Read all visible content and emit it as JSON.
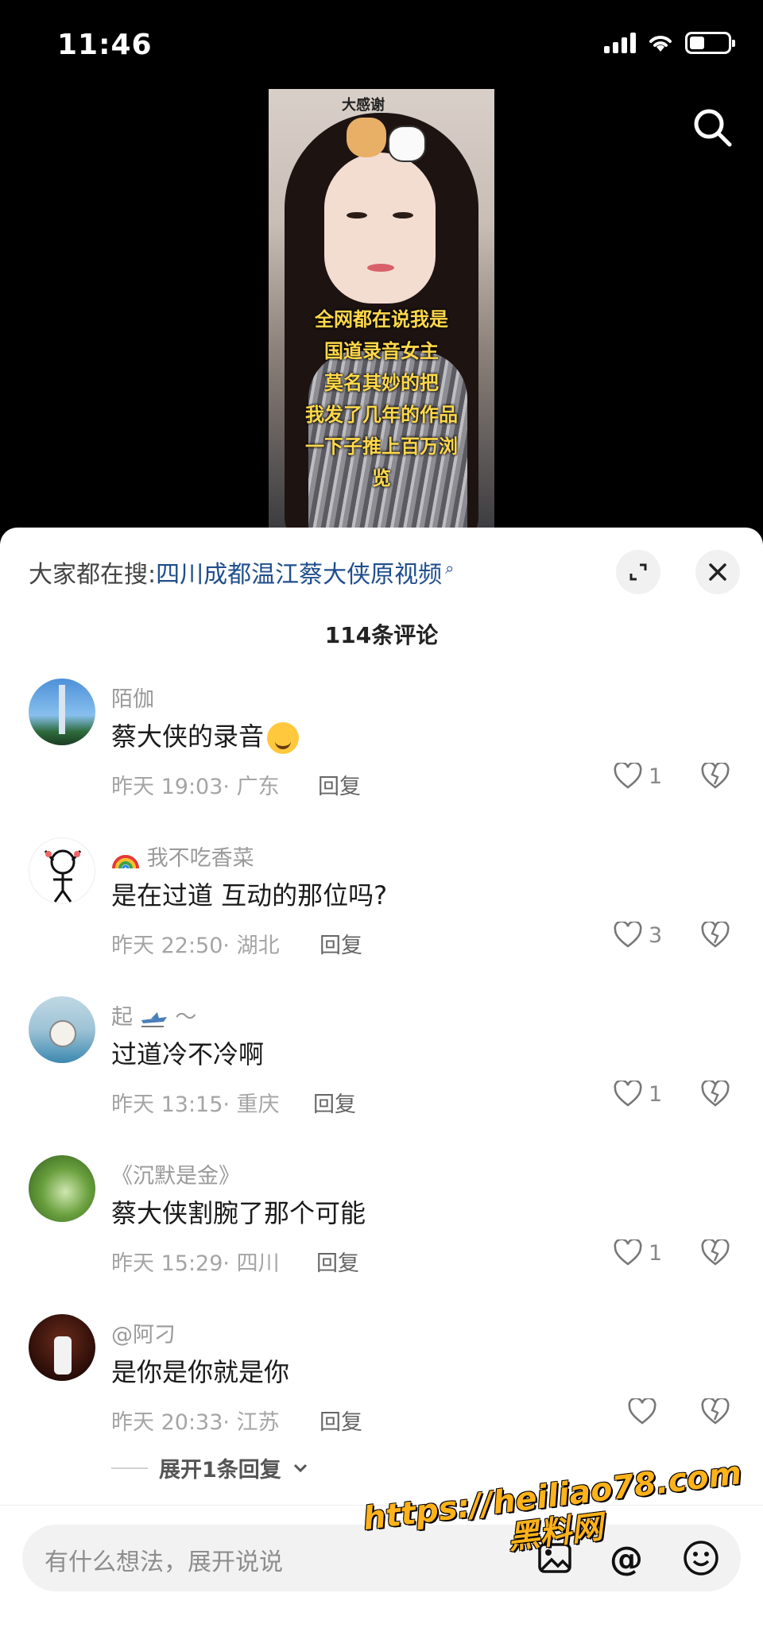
{
  "status_bar": {
    "time": "11:46"
  },
  "video": {
    "sticker_text": "大感谢",
    "caption_lines": [
      "全网都在说我是",
      "国道录音女主",
      "莫名其妙的把",
      "我发了几年的作品",
      "一下子推上百万浏",
      "览"
    ]
  },
  "panel": {
    "hot_search_label": "大家都在搜:",
    "hot_search_query": "四川成都温江蔡大侠原视频",
    "comment_count": "114条评论",
    "reply_label": "回复",
    "comments": [
      {
        "username": "陌伽",
        "text": "蔡大侠的录音",
        "time": "昨天 19:03",
        "location": "广东",
        "likes": "1"
      },
      {
        "username": "我不吃香菜",
        "text": "是在过道 互动的那位吗?",
        "time": "昨天 22:50",
        "location": "湖北",
        "likes": "3"
      },
      {
        "username": "起",
        "username_suffix": "～",
        "text": "过道冷不冷啊",
        "time": "昨天 13:15",
        "location": "重庆",
        "likes": "1"
      },
      {
        "username": "《沉默是金》",
        "text": "蔡大侠割腕了那个可能",
        "time": "昨天 15:29",
        "location": "四川",
        "likes": "1"
      },
      {
        "username": "@阿刁",
        "text": "是你是你就是你",
        "time": "昨天 20:33",
        "location": "江苏",
        "likes": ""
      }
    ],
    "expand_replies": "展开1条回复"
  },
  "input": {
    "placeholder": "有什么想法，展开说说"
  },
  "watermark": {
    "line1": "https://heiliao78.com",
    "line2": "黑料网"
  },
  "colors": {
    "query": "#1f4e8c",
    "watermark": "#ffb219",
    "caption": "#ffd84a"
  }
}
